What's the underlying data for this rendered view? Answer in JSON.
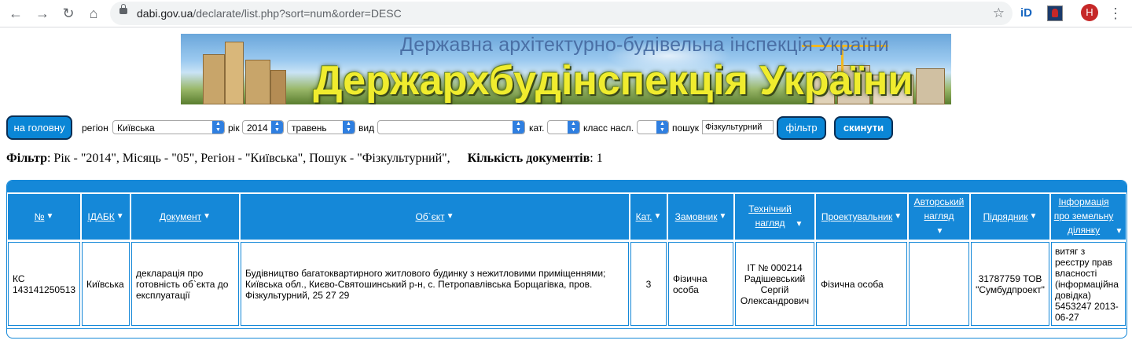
{
  "browser": {
    "url_host": "dabi.gov.ua",
    "url_path": "/declarate/list.php?sort=num&order=DESC",
    "ext_id_label": "iD",
    "avatar_letter": "H",
    "icons": [
      "back-icon",
      "forward-icon",
      "reload-icon",
      "home-icon",
      "lock-icon",
      "star-icon",
      "menu-icon"
    ]
  },
  "banner": {
    "subtitle": "Державна архітектурно-будівельна інспекція України",
    "title": "Держархбудінспекція України"
  },
  "filters": {
    "home_button": "на головну",
    "region_label": "регіон",
    "region_value": "Київська",
    "year_label": "рік",
    "year_value": "2014",
    "month_value": "травень",
    "type_label": "вид",
    "type_value": "",
    "category_label": "кат.",
    "category_value": "",
    "class_label": "класс насл.",
    "class_value": "",
    "search_label": "пошук",
    "search_value": "Фізкультурний",
    "filter_button": "фільтр",
    "reset_button": "скинути"
  },
  "summary": {
    "filter_label": "Фільтр",
    "filter_text": ": Рік - \"2014\", Місяць - \"05\", Регіон - \"Київська\", Пошук - \"Фізкультурний\",",
    "count_label": "Кількість документів",
    "count_text": ": 1"
  },
  "table": {
    "headers": [
      "№",
      "ІДАБК",
      "Документ",
      "Об`єкт",
      "Кат.",
      "Замовник",
      "Технічний нагляд",
      "Проектувальник",
      "Авторський нагляд",
      "Підрядник",
      "Інформація про земельну ділянку"
    ],
    "rows": [
      {
        "num": "КС 143141250513",
        "idabk": "Київська",
        "document": "декларація про готовність об`єкта до експлуатації",
        "object": "Будівництво багатоквартирного житлового будинку з нежитловими приміщеннями; Київська обл., Києво-Святошинський р-н, с. Петропавлівська Борщагівка, пров. Фізкультурний, 25 27 29",
        "category": "3",
        "customer": "Фізична особа",
        "tech_supervision": "ІТ № 000214 Радішевський Сергій Олександрович",
        "designer": "Фізична особа",
        "author_supervision": "",
        "contractor": "31787759 ТОВ \"Сумбудпроект\"",
        "land_info": "витяг з реєстру прав власності (інформаційна довідка) 5453247 2013-06-27"
      }
    ]
  },
  "colors": {
    "table_blue": "#1588d8",
    "button_blue": "#0a86d6",
    "button_border": "#0b2e53",
    "banner_title": "#f0ec2e"
  }
}
